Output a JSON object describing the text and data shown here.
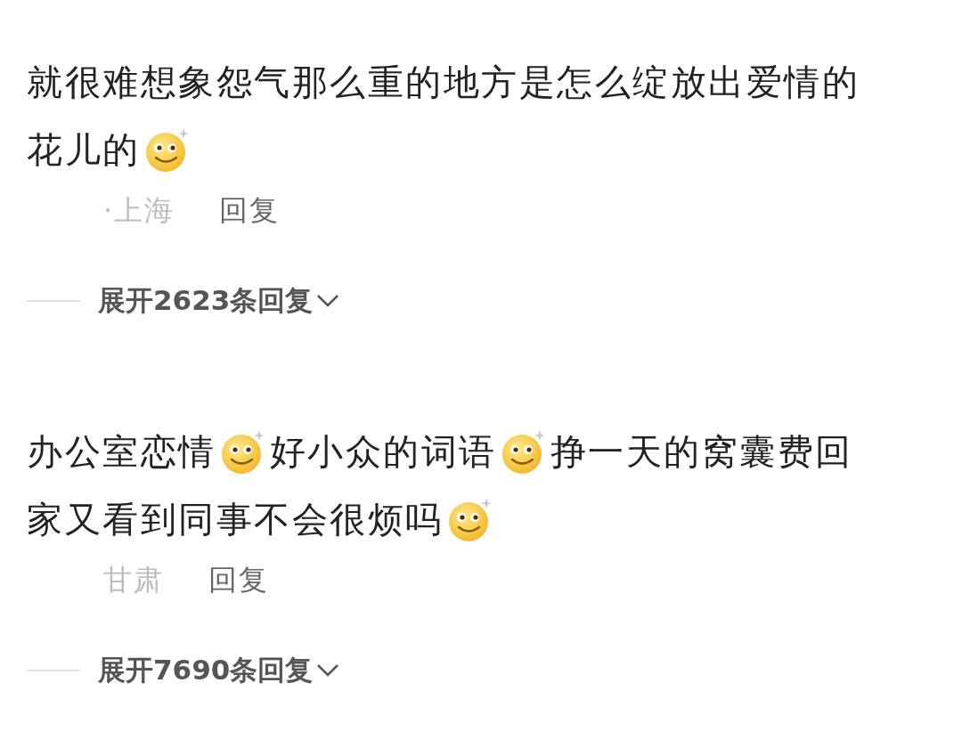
{
  "comments": [
    {
      "lines": [
        [
          {
            "kind": "text",
            "text": "就很难想象怨气那么重的地方是怎么绽放出爱情的"
          }
        ],
        [
          {
            "kind": "text",
            "text": "花儿的"
          },
          {
            "kind": "emoji"
          }
        ]
      ],
      "location": "·上海",
      "reply": "回复",
      "expand": "展开2623条回复"
    },
    {
      "lines": [
        [
          {
            "kind": "text",
            "text": "办公室恋情"
          },
          {
            "kind": "emoji"
          },
          {
            "kind": "text",
            "text": "好小众的词语"
          },
          {
            "kind": "emoji"
          },
          {
            "kind": "text",
            "text": "挣一天的窝囊费回"
          }
        ],
        [
          {
            "kind": "text",
            "text": "家又看到同事不会很烦吗"
          },
          {
            "kind": "emoji"
          }
        ]
      ],
      "location": "甘肃",
      "reply": "回复",
      "expand": "展开7690条回复"
    }
  ]
}
